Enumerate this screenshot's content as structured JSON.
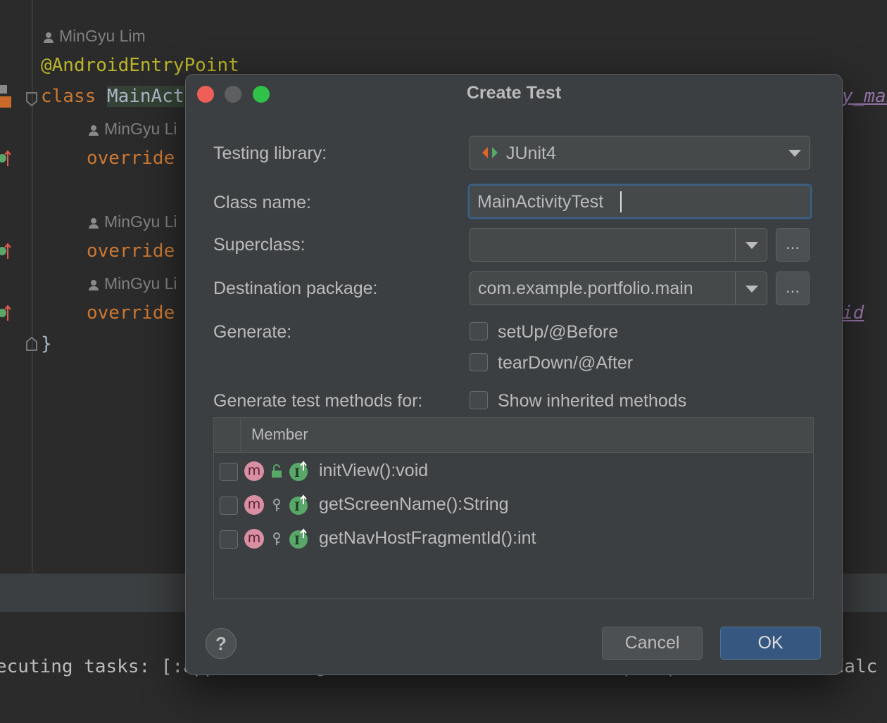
{
  "editor": {
    "author": "MinGyu Lim",
    "author_trunc": "MinGyu Li",
    "annotation": "@AndroidEntryPoint",
    "class_kw": "class",
    "class_name": "MainAct",
    "override_kw": "override",
    "closing_brace": "}",
    "right_frag_1": "y_mai",
    "right_frag_2": "id"
  },
  "console": {
    "text": "ecuting tasks: [:app:testDebugUnitTest, --tests, com.example.portfolio.test.Calc"
  },
  "dialog": {
    "title": "Create Test",
    "testing_library_label": "Testing library:",
    "testing_library_value": "JUnit4",
    "class_name_label": "Class name:",
    "class_name_value": "MainActivityTest",
    "superclass_label": "Superclass:",
    "superclass_value": "",
    "destination_package_label": "Destination package:",
    "destination_package_value": "com.example.portfolio.main",
    "browse_label": "...",
    "generate_label": "Generate:",
    "generate_options": [
      {
        "label": "setUp/@Before",
        "checked": false
      },
      {
        "label": "tearDown/@After",
        "checked": false
      }
    ],
    "methods_for_label": "Generate test methods for:",
    "show_inherited_label": "Show inherited methods",
    "table_header": "Member",
    "members": [
      {
        "name": "initView():void",
        "visibility": "public",
        "checked": false
      },
      {
        "name": "getScreenName():String",
        "visibility": "protected",
        "checked": false
      },
      {
        "name": "getNavHostFragmentId():int",
        "visibility": "protected",
        "checked": false
      }
    ],
    "member_icon_letter": "m",
    "help_label": "?",
    "cancel_label": "Cancel",
    "ok_label": "OK"
  }
}
